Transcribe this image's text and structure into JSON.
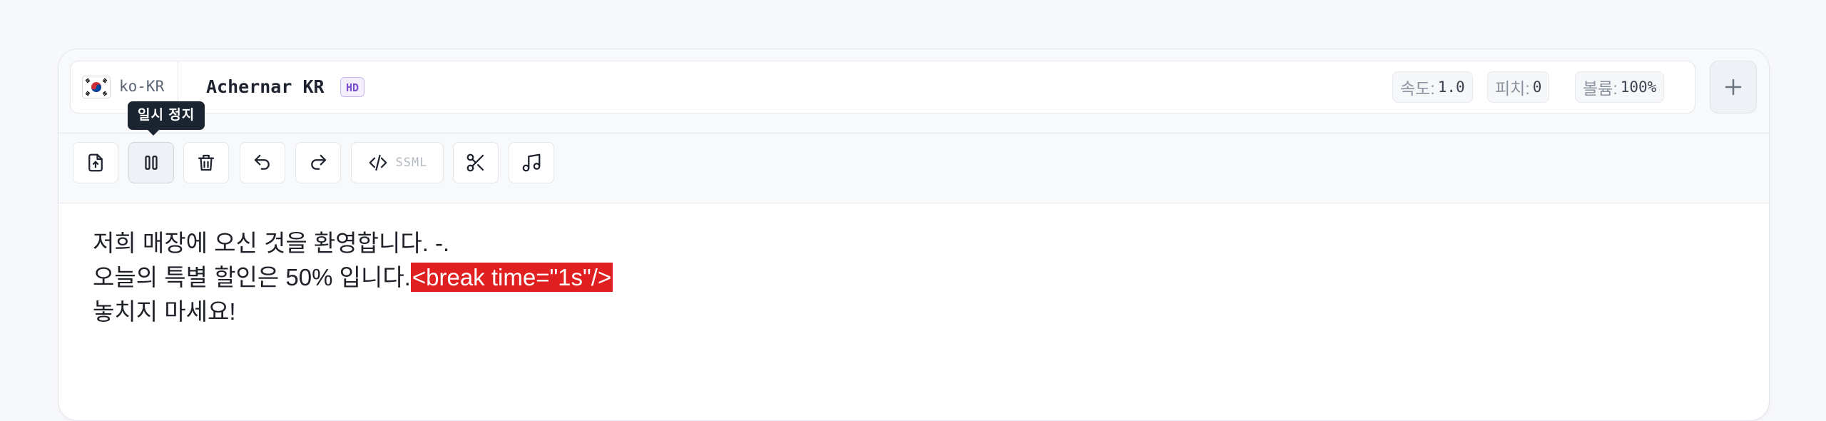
{
  "header": {
    "language_code": "ko-KR",
    "voice_name": "Achernar KR",
    "quality_badge": "HD",
    "params": [
      {
        "label": "속도:",
        "value": "1.0"
      },
      {
        "label": "피치:",
        "value": "0"
      },
      {
        "label": "볼륨:",
        "value": "100%"
      }
    ],
    "add_icon": "plus-icon"
  },
  "toolbar": {
    "tooltip": "일시 정지",
    "ssml_label": "SSML",
    "tools": [
      {
        "icon": "upload-file-icon"
      },
      {
        "icon": "pause-icon"
      },
      {
        "icon": "trash-icon"
      },
      {
        "icon": "undo-icon"
      },
      {
        "icon": "redo-icon"
      },
      {
        "icon": "code-icon"
      },
      {
        "icon": "scissors-icon"
      },
      {
        "icon": "music-note-icon"
      }
    ]
  },
  "editor": {
    "line1": "저희 매장에 오신 것을 환영합니다. -.",
    "line2_text": "오늘의 특별 할인은 50% 입니다.",
    "line2_tag": "<break time=\"1s\"/>",
    "line3": "놓치지 마세요!"
  },
  "colors": {
    "break_highlight": "#e02020",
    "hd_badge": "#7a4fcf",
    "tooltip_bg": "#1b2532"
  }
}
